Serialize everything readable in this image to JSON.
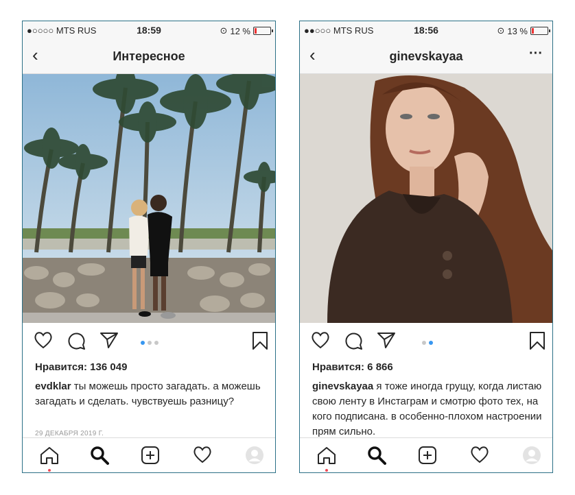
{
  "left": {
    "status": {
      "carrier": "●○○○○ MTS RUS",
      "time": "18:59",
      "battery": "12 %",
      "battery_level": 0.12
    },
    "nav": {
      "title": "Интересное"
    },
    "likes": "Нравится: 136 049",
    "caption": {
      "user": "evdklar",
      "text": "ты можешь просто загадать. а можешь загадать и сделать. чувствуешь разницу?"
    },
    "date": "29 ДЕКАБРЯ 2019 Г.",
    "carousel": {
      "count": 3,
      "active": 1
    }
  },
  "right": {
    "status": {
      "carrier": "●●○○○ MTS RUS",
      "time": "18:56",
      "battery": "13 %",
      "battery_level": 0.13
    },
    "nav": {
      "title": "ginevskayaa",
      "more": "···"
    },
    "likes": "Нравится: 6 866",
    "caption": {
      "user": "ginevskayaa",
      "text": "я тоже иногда грущу, когда листаю свою ленту в Инстаграм и смотрю фото тех, на кого подписана. в особенно-плохом настроении прям сильно."
    },
    "carousel": {
      "count": 2,
      "active": 2
    }
  },
  "nav_back": "‹",
  "icons": {
    "like": "heart-icon",
    "comment": "comment-icon",
    "share": "send-icon",
    "save": "bookmark-icon",
    "home": "home-icon",
    "search": "search-icon",
    "add": "add-post-icon",
    "activity": "heart-icon",
    "profile": "avatar"
  },
  "colors": {
    "accent": "#3897f0",
    "notification": "#ed4956",
    "battery_low": "#e33333"
  }
}
